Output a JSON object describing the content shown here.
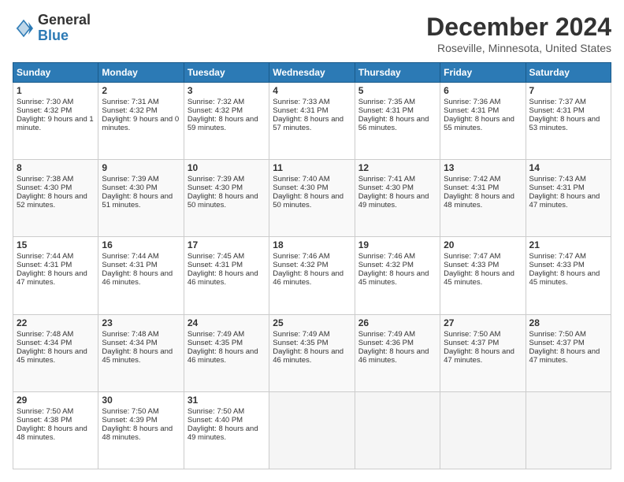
{
  "header": {
    "logo_line1": "General",
    "logo_line2": "Blue",
    "month_title": "December 2024",
    "location": "Roseville, Minnesota, United States"
  },
  "days_of_week": [
    "Sunday",
    "Monday",
    "Tuesday",
    "Wednesday",
    "Thursday",
    "Friday",
    "Saturday"
  ],
  "weeks": [
    [
      {
        "day": "1",
        "sunrise": "Sunrise: 7:30 AM",
        "sunset": "Sunset: 4:32 PM",
        "daylight": "Daylight: 9 hours and 1 minute."
      },
      {
        "day": "2",
        "sunrise": "Sunrise: 7:31 AM",
        "sunset": "Sunset: 4:32 PM",
        "daylight": "Daylight: 9 hours and 0 minutes."
      },
      {
        "day": "3",
        "sunrise": "Sunrise: 7:32 AM",
        "sunset": "Sunset: 4:32 PM",
        "daylight": "Daylight: 8 hours and 59 minutes."
      },
      {
        "day": "4",
        "sunrise": "Sunrise: 7:33 AM",
        "sunset": "Sunset: 4:31 PM",
        "daylight": "Daylight: 8 hours and 57 minutes."
      },
      {
        "day": "5",
        "sunrise": "Sunrise: 7:35 AM",
        "sunset": "Sunset: 4:31 PM",
        "daylight": "Daylight: 8 hours and 56 minutes."
      },
      {
        "day": "6",
        "sunrise": "Sunrise: 7:36 AM",
        "sunset": "Sunset: 4:31 PM",
        "daylight": "Daylight: 8 hours and 55 minutes."
      },
      {
        "day": "7",
        "sunrise": "Sunrise: 7:37 AM",
        "sunset": "Sunset: 4:31 PM",
        "daylight": "Daylight: 8 hours and 53 minutes."
      }
    ],
    [
      {
        "day": "8",
        "sunrise": "Sunrise: 7:38 AM",
        "sunset": "Sunset: 4:30 PM",
        "daylight": "Daylight: 8 hours and 52 minutes."
      },
      {
        "day": "9",
        "sunrise": "Sunrise: 7:39 AM",
        "sunset": "Sunset: 4:30 PM",
        "daylight": "Daylight: 8 hours and 51 minutes."
      },
      {
        "day": "10",
        "sunrise": "Sunrise: 7:39 AM",
        "sunset": "Sunset: 4:30 PM",
        "daylight": "Daylight: 8 hours and 50 minutes."
      },
      {
        "day": "11",
        "sunrise": "Sunrise: 7:40 AM",
        "sunset": "Sunset: 4:30 PM",
        "daylight": "Daylight: 8 hours and 50 minutes."
      },
      {
        "day": "12",
        "sunrise": "Sunrise: 7:41 AM",
        "sunset": "Sunset: 4:30 PM",
        "daylight": "Daylight: 8 hours and 49 minutes."
      },
      {
        "day": "13",
        "sunrise": "Sunrise: 7:42 AM",
        "sunset": "Sunset: 4:31 PM",
        "daylight": "Daylight: 8 hours and 48 minutes."
      },
      {
        "day": "14",
        "sunrise": "Sunrise: 7:43 AM",
        "sunset": "Sunset: 4:31 PM",
        "daylight": "Daylight: 8 hours and 47 minutes."
      }
    ],
    [
      {
        "day": "15",
        "sunrise": "Sunrise: 7:44 AM",
        "sunset": "Sunset: 4:31 PM",
        "daylight": "Daylight: 8 hours and 47 minutes."
      },
      {
        "day": "16",
        "sunrise": "Sunrise: 7:44 AM",
        "sunset": "Sunset: 4:31 PM",
        "daylight": "Daylight: 8 hours and 46 minutes."
      },
      {
        "day": "17",
        "sunrise": "Sunrise: 7:45 AM",
        "sunset": "Sunset: 4:31 PM",
        "daylight": "Daylight: 8 hours and 46 minutes."
      },
      {
        "day": "18",
        "sunrise": "Sunrise: 7:46 AM",
        "sunset": "Sunset: 4:32 PM",
        "daylight": "Daylight: 8 hours and 46 minutes."
      },
      {
        "day": "19",
        "sunrise": "Sunrise: 7:46 AM",
        "sunset": "Sunset: 4:32 PM",
        "daylight": "Daylight: 8 hours and 45 minutes."
      },
      {
        "day": "20",
        "sunrise": "Sunrise: 7:47 AM",
        "sunset": "Sunset: 4:33 PM",
        "daylight": "Daylight: 8 hours and 45 minutes."
      },
      {
        "day": "21",
        "sunrise": "Sunrise: 7:47 AM",
        "sunset": "Sunset: 4:33 PM",
        "daylight": "Daylight: 8 hours and 45 minutes."
      }
    ],
    [
      {
        "day": "22",
        "sunrise": "Sunrise: 7:48 AM",
        "sunset": "Sunset: 4:34 PM",
        "daylight": "Daylight: 8 hours and 45 minutes."
      },
      {
        "day": "23",
        "sunrise": "Sunrise: 7:48 AM",
        "sunset": "Sunset: 4:34 PM",
        "daylight": "Daylight: 8 hours and 45 minutes."
      },
      {
        "day": "24",
        "sunrise": "Sunrise: 7:49 AM",
        "sunset": "Sunset: 4:35 PM",
        "daylight": "Daylight: 8 hours and 46 minutes."
      },
      {
        "day": "25",
        "sunrise": "Sunrise: 7:49 AM",
        "sunset": "Sunset: 4:35 PM",
        "daylight": "Daylight: 8 hours and 46 minutes."
      },
      {
        "day": "26",
        "sunrise": "Sunrise: 7:49 AM",
        "sunset": "Sunset: 4:36 PM",
        "daylight": "Daylight: 8 hours and 46 minutes."
      },
      {
        "day": "27",
        "sunrise": "Sunrise: 7:50 AM",
        "sunset": "Sunset: 4:37 PM",
        "daylight": "Daylight: 8 hours and 47 minutes."
      },
      {
        "day": "28",
        "sunrise": "Sunrise: 7:50 AM",
        "sunset": "Sunset: 4:37 PM",
        "daylight": "Daylight: 8 hours and 47 minutes."
      }
    ],
    [
      {
        "day": "29",
        "sunrise": "Sunrise: 7:50 AM",
        "sunset": "Sunset: 4:38 PM",
        "daylight": "Daylight: 8 hours and 48 minutes."
      },
      {
        "day": "30",
        "sunrise": "Sunrise: 7:50 AM",
        "sunset": "Sunset: 4:39 PM",
        "daylight": "Daylight: 8 hours and 48 minutes."
      },
      {
        "day": "31",
        "sunrise": "Sunrise: 7:50 AM",
        "sunset": "Sunset: 4:40 PM",
        "daylight": "Daylight: 8 hours and 49 minutes."
      },
      {
        "day": "",
        "sunrise": "",
        "sunset": "",
        "daylight": ""
      },
      {
        "day": "",
        "sunrise": "",
        "sunset": "",
        "daylight": ""
      },
      {
        "day": "",
        "sunrise": "",
        "sunset": "",
        "daylight": ""
      },
      {
        "day": "",
        "sunrise": "",
        "sunset": "",
        "daylight": ""
      }
    ]
  ]
}
